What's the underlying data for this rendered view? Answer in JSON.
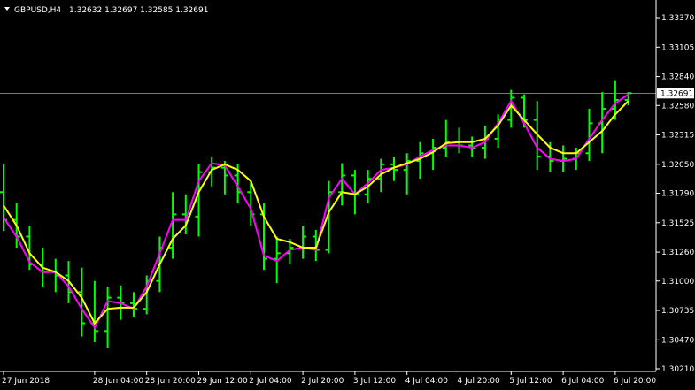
{
  "header": {
    "symbol": "GBPUSD,H4",
    "ohlc": "1.32632 1.32697 1.32585 1.32691"
  },
  "colors": {
    "background": "#000000",
    "bars": "#00ff00",
    "ma_fast": "#ff00ff",
    "ma_slow": "#ffff00",
    "axis": "#ffffff",
    "price_line": "#c0c0c0"
  },
  "chart_data": {
    "type": "line",
    "title": "",
    "ylim": [
      1.3021,
      1.3337
    ],
    "y_ticks": [
      "1.33370",
      "1.33105",
      "1.32840",
      "1.32580",
      "1.32315",
      "1.32050",
      "1.31790",
      "1.31525",
      "1.31260",
      "1.31000",
      "1.30735",
      "1.30470",
      "1.30210"
    ],
    "x_ticks": [
      {
        "label": "27 Jun 2018",
        "i": 0
      },
      {
        "label": "28 Jun 04:00",
        "i": 7
      },
      {
        "label": "28 Jun 20:00",
        "i": 11
      },
      {
        "label": "29 Jun 12:00",
        "i": 15
      },
      {
        "label": "2 Jul 04:00",
        "i": 19
      },
      {
        "label": "2 Jul 20:00",
        "i": 23
      },
      {
        "label": "3 Jul 12:00",
        "i": 27
      },
      {
        "label": "4 Jul 04:00",
        "i": 31
      },
      {
        "label": "4 Jul 20:00",
        "i": 35
      },
      {
        "label": "5 Jul 12:00",
        "i": 39
      },
      {
        "label": "6 Jul 04:00",
        "i": 43
      },
      {
        "label": "6 Jul 20:00",
        "i": 47
      }
    ],
    "current_price": "1.32691",
    "current_price_value": 1.32691,
    "bars": [
      {
        "o": 1.318,
        "h": 1.3205,
        "l": 1.3145,
        "c": 1.3155
      },
      {
        "o": 1.3155,
        "h": 1.317,
        "l": 1.313,
        "c": 1.314
      },
      {
        "o": 1.314,
        "h": 1.315,
        "l": 1.311,
        "c": 1.3115
      },
      {
        "o": 1.3115,
        "h": 1.313,
        "l": 1.3095,
        "c": 1.3108
      },
      {
        "o": 1.3108,
        "h": 1.312,
        "l": 1.309,
        "c": 1.3105
      },
      {
        "o": 1.3105,
        "h": 1.3118,
        "l": 1.308,
        "c": 1.309
      },
      {
        "o": 1.309,
        "h": 1.3112,
        "l": 1.305,
        "c": 1.3062
      },
      {
        "o": 1.3062,
        "h": 1.31,
        "l": 1.3045,
        "c": 1.3055
      },
      {
        "o": 1.3055,
        "h": 1.3095,
        "l": 1.304,
        "c": 1.3085
      },
      {
        "o": 1.3085,
        "h": 1.3096,
        "l": 1.3065,
        "c": 1.308
      },
      {
        "o": 1.308,
        "h": 1.309,
        "l": 1.3068,
        "c": 1.3075
      },
      {
        "o": 1.3075,
        "h": 1.3105,
        "l": 1.307,
        "c": 1.31
      },
      {
        "o": 1.31,
        "h": 1.314,
        "l": 1.309,
        "c": 1.313
      },
      {
        "o": 1.313,
        "h": 1.318,
        "l": 1.312,
        "c": 1.316
      },
      {
        "o": 1.316,
        "h": 1.3178,
        "l": 1.3142,
        "c": 1.3158
      },
      {
        "o": 1.3158,
        "h": 1.3205,
        "l": 1.314,
        "c": 1.3198
      },
      {
        "o": 1.3198,
        "h": 1.3212,
        "l": 1.3185,
        "c": 1.3202
      },
      {
        "o": 1.3202,
        "h": 1.3208,
        "l": 1.3178,
        "c": 1.3195
      },
      {
        "o": 1.3195,
        "h": 1.3205,
        "l": 1.317,
        "c": 1.318
      },
      {
        "o": 1.318,
        "h": 1.319,
        "l": 1.315,
        "c": 1.316
      },
      {
        "o": 1.316,
        "h": 1.317,
        "l": 1.311,
        "c": 1.312
      },
      {
        "o": 1.312,
        "h": 1.314,
        "l": 1.3098,
        "c": 1.3125
      },
      {
        "o": 1.3125,
        "h": 1.3138,
        "l": 1.3115,
        "c": 1.313
      },
      {
        "o": 1.313,
        "h": 1.315,
        "l": 1.312,
        "c": 1.314
      },
      {
        "o": 1.314,
        "h": 1.3146,
        "l": 1.3118,
        "c": 1.3128
      },
      {
        "o": 1.3128,
        "h": 1.319,
        "l": 1.3125,
        "c": 1.318
      },
      {
        "o": 1.318,
        "h": 1.3206,
        "l": 1.3168,
        "c": 1.3195
      },
      {
        "o": 1.3195,
        "h": 1.32,
        "l": 1.316,
        "c": 1.3178
      },
      {
        "o": 1.3178,
        "h": 1.32,
        "l": 1.317,
        "c": 1.3192
      },
      {
        "o": 1.3192,
        "h": 1.321,
        "l": 1.318,
        "c": 1.3205
      },
      {
        "o": 1.3205,
        "h": 1.3212,
        "l": 1.319,
        "c": 1.32
      },
      {
        "o": 1.32,
        "h": 1.3215,
        "l": 1.3178,
        "c": 1.3208
      },
      {
        "o": 1.3208,
        "h": 1.3225,
        "l": 1.3192,
        "c": 1.3215
      },
      {
        "o": 1.3215,
        "h": 1.3228,
        "l": 1.32,
        "c": 1.322
      },
      {
        "o": 1.322,
        "h": 1.3245,
        "l": 1.3212,
        "c": 1.3225
      },
      {
        "o": 1.3225,
        "h": 1.3238,
        "l": 1.3215,
        "c": 1.3222
      },
      {
        "o": 1.3222,
        "h": 1.323,
        "l": 1.3212,
        "c": 1.322
      },
      {
        "o": 1.322,
        "h": 1.324,
        "l": 1.321,
        "c": 1.3228
      },
      {
        "o": 1.3228,
        "h": 1.325,
        "l": 1.322,
        "c": 1.3245
      },
      {
        "o": 1.3245,
        "h": 1.3272,
        "l": 1.3238,
        "c": 1.3265
      },
      {
        "o": 1.3265,
        "h": 1.3268,
        "l": 1.3238,
        "c": 1.3245
      },
      {
        "o": 1.3245,
        "h": 1.3262,
        "l": 1.32,
        "c": 1.3212
      },
      {
        "o": 1.3212,
        "h": 1.3225,
        "l": 1.3198,
        "c": 1.3208
      },
      {
        "o": 1.3208,
        "h": 1.3222,
        "l": 1.3198,
        "c": 1.321
      },
      {
        "o": 1.321,
        "h": 1.322,
        "l": 1.32,
        "c": 1.3215
      },
      {
        "o": 1.3215,
        "h": 1.3255,
        "l": 1.3208,
        "c": 1.3242
      },
      {
        "o": 1.3242,
        "h": 1.327,
        "l": 1.3215,
        "c": 1.3255
      },
      {
        "o": 1.3255,
        "h": 1.328,
        "l": 1.3245,
        "c": 1.3263
      },
      {
        "o": 1.3263,
        "h": 1.327,
        "l": 1.3258,
        "c": 1.32691
      }
    ],
    "series": [
      {
        "values": [
          1.3157,
          1.314,
          1.3117,
          1.3108,
          1.3108,
          1.3095,
          1.3075,
          1.3058,
          1.3082,
          1.308,
          1.3075,
          1.3095,
          1.3125,
          1.3155,
          1.3155,
          1.319,
          1.3206,
          1.3204,
          1.3185,
          1.3165,
          1.3123,
          1.3118,
          1.3128,
          1.313,
          1.3128,
          1.3175,
          1.3192,
          1.3178,
          1.3188,
          1.32,
          1.3202,
          1.3205,
          1.3212,
          1.3218,
          1.3222,
          1.3222,
          1.322,
          1.3225,
          1.3242,
          1.3262,
          1.3242,
          1.322,
          1.321,
          1.3208,
          1.321,
          1.3228,
          1.3245,
          1.326,
          1.3268
        ]
      },
      {
        "values": [
          1.3168,
          1.315,
          1.3125,
          1.3112,
          1.3108,
          1.31,
          1.3085,
          1.3062,
          1.3075,
          1.3076,
          1.3076,
          1.309,
          1.3115,
          1.3138,
          1.315,
          1.318,
          1.32,
          1.3205,
          1.32,
          1.319,
          1.3158,
          1.3138,
          1.3135,
          1.313,
          1.313,
          1.3162,
          1.318,
          1.3178,
          1.3185,
          1.3196,
          1.3202,
          1.3206,
          1.321,
          1.3216,
          1.3224,
          1.3225,
          1.3225,
          1.3228,
          1.324,
          1.3258,
          1.3245,
          1.3232,
          1.322,
          1.3215,
          1.3215,
          1.3225,
          1.3235,
          1.325,
          1.3262
        ]
      }
    ]
  }
}
